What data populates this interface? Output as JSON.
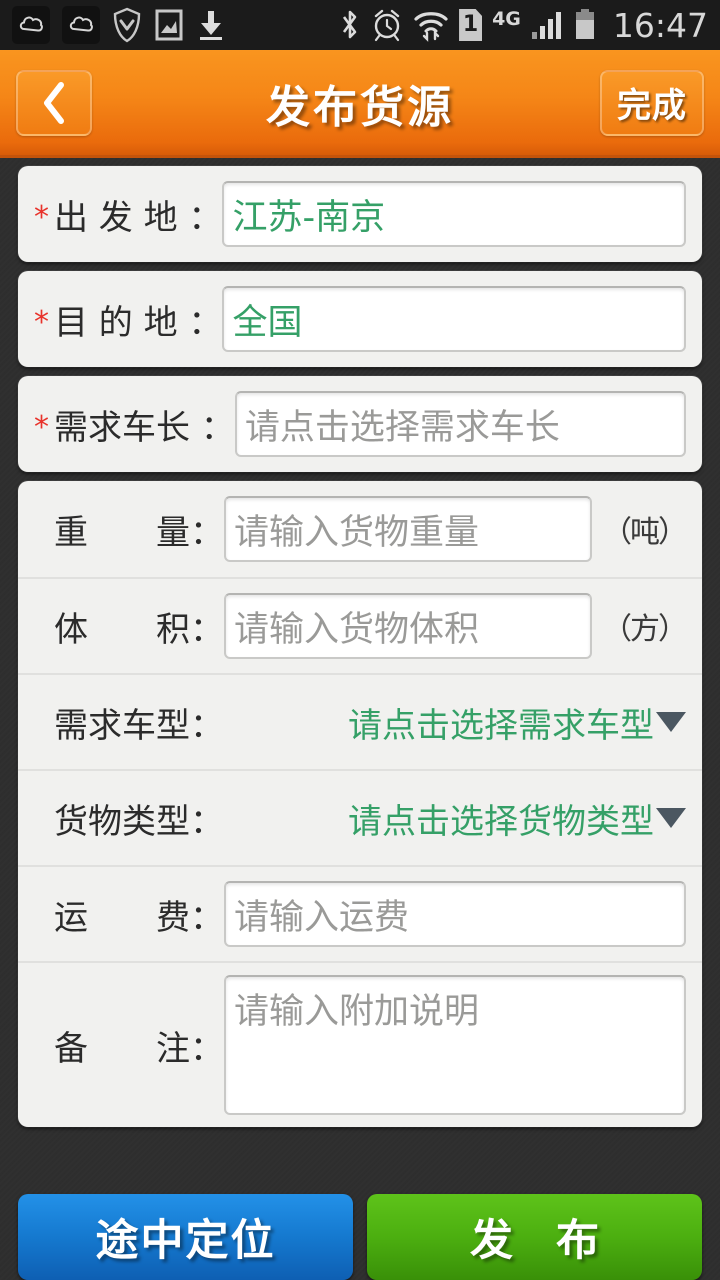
{
  "statusbar": {
    "time": "16:47",
    "network_label": "4G",
    "sim_label": "1",
    "left_icons": [
      "cloud-badge-icon",
      "cloud-badge-icon",
      "shield-icon",
      "image-icon",
      "download-icon"
    ],
    "right_icons": [
      "bluetooth-icon",
      "alarm-clock-icon",
      "wifi-icon",
      "sim-icon",
      "network-4g-label",
      "signal-bars-icon",
      "battery-icon"
    ]
  },
  "header": {
    "title": "发布货源",
    "back_icon": "chevron-left-icon",
    "done_label": "完成",
    "bg_color": "#f58617"
  },
  "form": {
    "required_marker": "*",
    "origin": {
      "label": "出 发 地 ：",
      "value": "江苏-南京",
      "required": true
    },
    "destination": {
      "label": "目 的 地 ：",
      "value": "全国",
      "required": true
    },
    "truck_length": {
      "label": "需求车长 ：",
      "placeholder": "请点击选择需求车长",
      "required": true
    },
    "weight": {
      "label": "重　　量：",
      "placeholder": "请输入货物重量",
      "unit": "（吨）"
    },
    "volume": {
      "label": "体　　积：",
      "placeholder": "请输入货物体积",
      "unit": "（方）"
    },
    "truck_type": {
      "label": "需求车型：",
      "value": "请点击选择需求车型",
      "caret_icon": "chevron-down-icon"
    },
    "cargo_type": {
      "label": "货物类型：",
      "value": "请点击选择货物类型",
      "caret_icon": "chevron-down-icon"
    },
    "freight": {
      "label": "运　　费：",
      "placeholder": "请输入运费"
    },
    "remark": {
      "label": "备　　注：",
      "placeholder": "请输入附加说明"
    }
  },
  "footer": {
    "locate_label": "途中定位",
    "publish_label": "发 布",
    "locate_color": "#1579cf",
    "publish_color": "#4caf10"
  },
  "colors": {
    "accent_orange": "#f58617",
    "value_green": "#35a067",
    "required_red": "#e8322a",
    "placeholder_gray": "#9a9a98",
    "background_dark": "#2e2e2e",
    "card_bg": "#f1f1ef"
  }
}
